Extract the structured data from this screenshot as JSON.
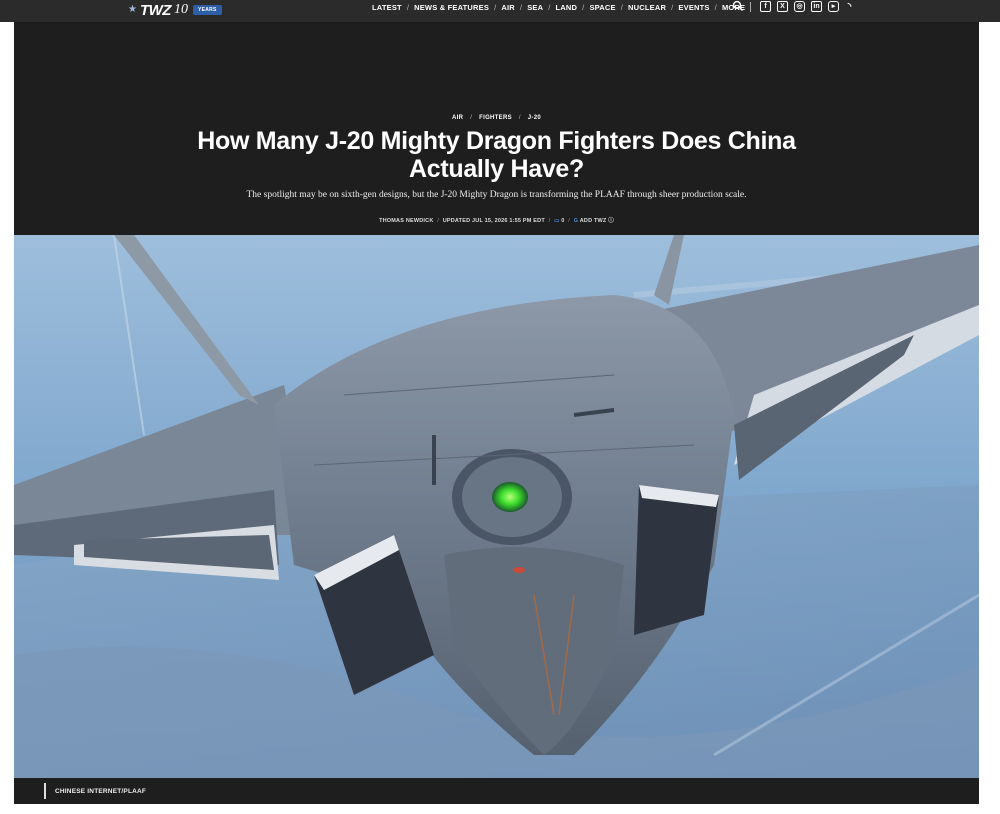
{
  "brand": {
    "logo_text": "TWZ",
    "logo_ten": "10",
    "logo_badge": "YEARS"
  },
  "nav": {
    "items": [
      {
        "label": "LATEST"
      },
      {
        "label": "NEWS & FEATURES"
      },
      {
        "label": "AIR"
      },
      {
        "label": "SEA"
      },
      {
        "label": "LAND"
      },
      {
        "label": "SPACE"
      },
      {
        "label": "NUCLEAR"
      },
      {
        "label": "EVENTS"
      },
      {
        "label": "MORE"
      }
    ],
    "search_icon": "search-icon",
    "socials": [
      "facebook-icon",
      "x-icon",
      "instagram-icon",
      "linkedin-icon",
      "youtube-icon",
      "rss-icon"
    ]
  },
  "article": {
    "breadcrumbs": [
      "AIR",
      "FIGHTERS",
      "J-20"
    ],
    "headline": "How Many J-20 Mighty Dragon Fighters Does China Actually Have?",
    "dek": "The spotlight may be on sixth-gen designs, but the J-20 Mighty Dragon is transforming the PLAAF through sheer production scale.",
    "author": "THOMAS NEWDICK",
    "updated": "UPDATED JUL 15, 2026 1:55 PM EDT",
    "comments": "0",
    "add_twz": "ADD TWZ",
    "photo_credit": "CHINESE INTERNET/PLAAF"
  },
  "colors": {
    "topbar": "#2b2b2b",
    "hero_bg": "#1e1e1e",
    "accent_blue": "#2f5ea8"
  }
}
